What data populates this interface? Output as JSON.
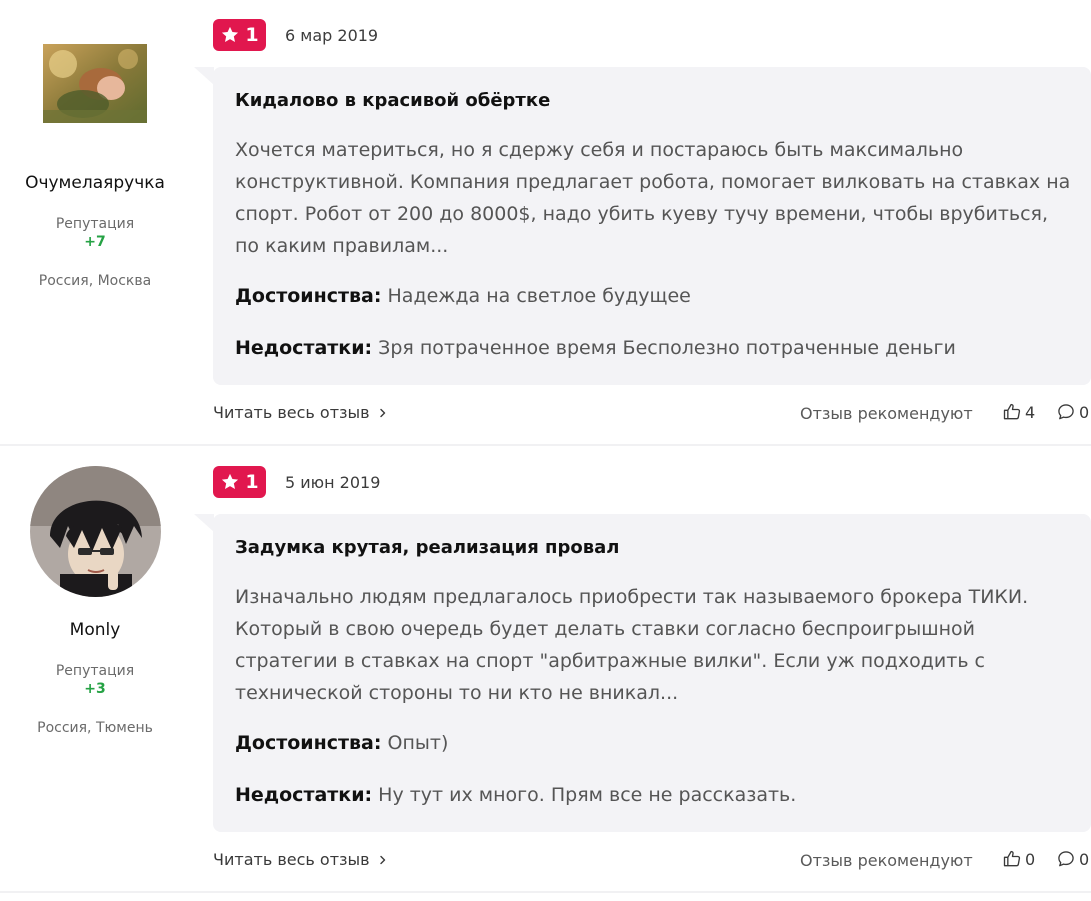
{
  "reviews": [
    {
      "author": "Очумелаяручка",
      "reputation_label": "Репутация",
      "reputation_value": "+7",
      "location": "Россия, Москва",
      "rating": "1",
      "date": "6 мар 2019",
      "title": "Кидалово в красивой обёртке",
      "text": "Хочется материться, но я сдержу себя и постараюсь быть максимально конструктивной. Компания предлагает робота, помогает вилковать на ставках на спорт. Робот от 200 до 8000$, надо убить куеву тучу времени, чтобы врубиться, по каким правилам...",
      "pros_label": "Достоинства:",
      "pros": "Надежда на светлое будущее",
      "cons_label": "Недостатки:",
      "cons": "Зря потраченное время Бесполезно потраченные деньги",
      "read_more": "Читать весь отзыв",
      "recommend": "Отзыв рекомендуют",
      "likes": "4",
      "comments": "0"
    },
    {
      "author": "Monly",
      "reputation_label": "Репутация",
      "reputation_value": "+3",
      "location": "Россия, Тюмень",
      "rating": "1",
      "date": "5 июн 2019",
      "title": "Задумка крутая, реализация провал",
      "text": "Изначально людям предлагалось приобрести так называемого брокера ТИКИ. Который в свою очередь будет делать ставки согласно беспроигрышной стратегии в ставках на спорт \"арбитражные вилки\". Если уж подходить с технической стороны то ни кто не вникал...",
      "pros_label": "Достоинства:",
      "pros": "Опыт)",
      "cons_label": "Недостатки:",
      "cons": "Ну тут их много. Прям все не рассказать.",
      "read_more": "Читать весь отзыв",
      "recommend": "Отзыв рекомендуют",
      "likes": "0",
      "comments": "0"
    }
  ],
  "colors": {
    "rating_badge": "#e1174e",
    "reputation_positive": "#25a244",
    "card_background": "#f3f3f6"
  },
  "icons": [
    "star-icon",
    "chevron-right-icon",
    "thumbs-up-icon",
    "comment-icon"
  ]
}
